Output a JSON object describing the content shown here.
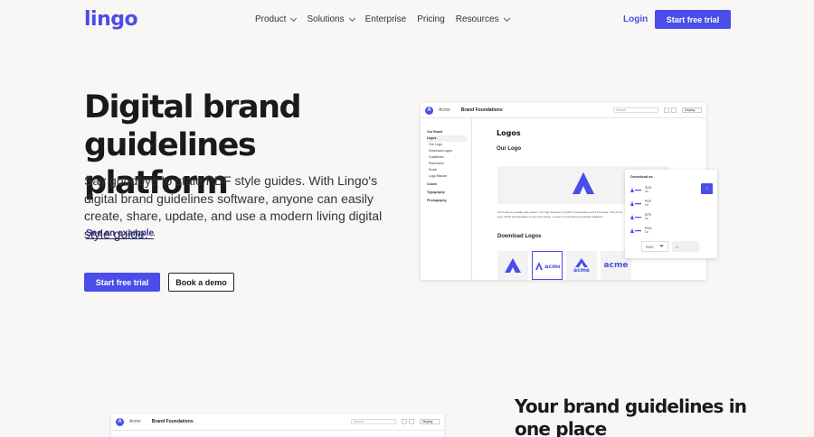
{
  "nav": {
    "logo": "lingo",
    "items": [
      {
        "label": "Product",
        "dropdown": true
      },
      {
        "label": "Solutions",
        "dropdown": true
      },
      {
        "label": "Enterprise",
        "dropdown": false
      },
      {
        "label": "Pricing",
        "dropdown": false
      },
      {
        "label": "Resources",
        "dropdown": true
      }
    ],
    "login": "Login",
    "cta": "Start free trial"
  },
  "hero": {
    "title": "Digital brand guidelines platform",
    "subtitle": "Say goodbye to stale PDF style guides. With Lingo's digital brand guidelines software, anyone can easily create, share, update, and use a modern living digital style guide.",
    "example_link": "See an example",
    "example_punct": ".",
    "primary_button": "Start free trial",
    "secondary_button": "Book a demo"
  },
  "mockup": {
    "acme": "Acme",
    "brand": "Brand Foundations",
    "search_placeholder": "Search",
    "display": "Display",
    "sidebar": [
      {
        "label": "Our Brand",
        "type": "sec"
      },
      {
        "label": "Logos",
        "type": "sec-active"
      },
      {
        "label": "Our Logo",
        "type": "sub"
      },
      {
        "label": "Download Logos",
        "type": "sub"
      },
      {
        "label": "Guidelines",
        "type": "sub"
      },
      {
        "label": "Placement",
        "type": "sub"
      },
      {
        "label": "Scale",
        "type": "sub"
      },
      {
        "label": "Logo Misuse",
        "type": "sub"
      },
      {
        "label": "Colors",
        "type": "sec"
      },
      {
        "label": "Typography",
        "type": "sec"
      },
      {
        "label": "Photography",
        "type": "sec"
      }
    ],
    "heading": "Logos",
    "our_logo": "Our Logo",
    "description": "Acme has a versatile logo system. Our logo features a symbol, a wordmark, and a full lockup. The Acme logo, which should always be the first choice, comes in horizontal and vertical variations.",
    "download_heading": "Download Logos",
    "tile_wordmark": "acme",
    "popover": {
      "title": "Download as",
      "formats": [
        {
          "name": "SVG",
          "scale": "1x"
        },
        {
          "name": "PDF",
          "scale": "1x"
        },
        {
          "name": "EPS",
          "scale": "1x"
        },
        {
          "name": "PNG",
          "scale": "1x"
        }
      ],
      "select_value": "SVG",
      "size_placeholder": "1x",
      "arrow": "↓"
    }
  },
  "section2": {
    "title": "Your brand guidelines in one place"
  },
  "colors": {
    "accent": "#4a4de8",
    "background": "#f8f7f5"
  }
}
